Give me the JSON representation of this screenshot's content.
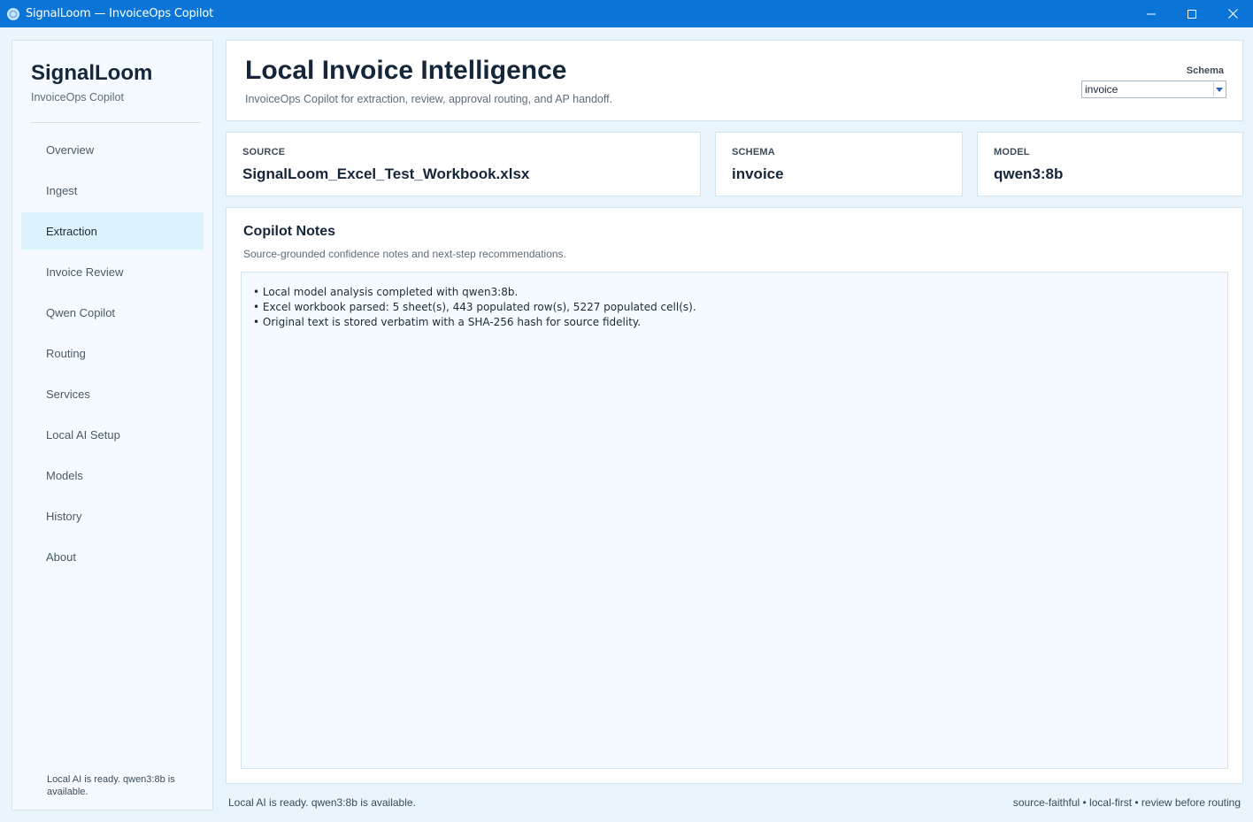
{
  "window": {
    "title": "SignalLoom — InvoiceOps Copilot",
    "app_icon": "signalloom-logo-icon",
    "controls": [
      "minimize-icon",
      "maximize-icon",
      "close-icon"
    ]
  },
  "sidebar": {
    "brand": "SignalLoom",
    "subtitle": "InvoiceOps Copilot",
    "items": [
      {
        "label": "Overview",
        "active": false
      },
      {
        "label": "Ingest",
        "active": false
      },
      {
        "label": "Extraction",
        "active": true
      },
      {
        "label": "Invoice Review",
        "active": false
      },
      {
        "label": "Qwen Copilot",
        "active": false
      },
      {
        "label": "Routing",
        "active": false
      },
      {
        "label": "Services",
        "active": false
      },
      {
        "label": "Local AI Setup",
        "active": false
      },
      {
        "label": "Models",
        "active": false
      },
      {
        "label": "History",
        "active": false
      },
      {
        "label": "About",
        "active": false
      }
    ],
    "status": "Local AI is ready. qwen3:8b is available."
  },
  "header": {
    "title": "Local Invoice Intelligence",
    "subtitle": "InvoiceOps Copilot for extraction, review, approval routing, and AP handoff.",
    "schema_label": "Schema",
    "schema_value": "invoice"
  },
  "cards": {
    "source": {
      "label": "SOURCE",
      "value": "SignalLoom_Excel_Test_Workbook.xlsx"
    },
    "schema": {
      "label": "SCHEMA",
      "value": "invoice"
    },
    "model": {
      "label": "MODEL",
      "value": "qwen3:8b"
    }
  },
  "notes": {
    "title": "Copilot Notes",
    "subtitle": "Source-grounded confidence notes and next-step recommendations.",
    "lines": [
      "• Local model analysis completed with qwen3:8b.",
      "• Excel workbook parsed: 5 sheet(s), 443 populated row(s), 5227 populated cell(s).",
      "• Original text is stored verbatim with a SHA-256 hash for source fidelity."
    ]
  },
  "statusbar": {
    "left": "Local AI is ready. qwen3:8b is available.",
    "right": "source-faithful • local-first • review before routing"
  },
  "colors": {
    "titlebar": "#0a75d6",
    "background": "#eaf4fc",
    "active_nav": "#dcf3fd"
  }
}
